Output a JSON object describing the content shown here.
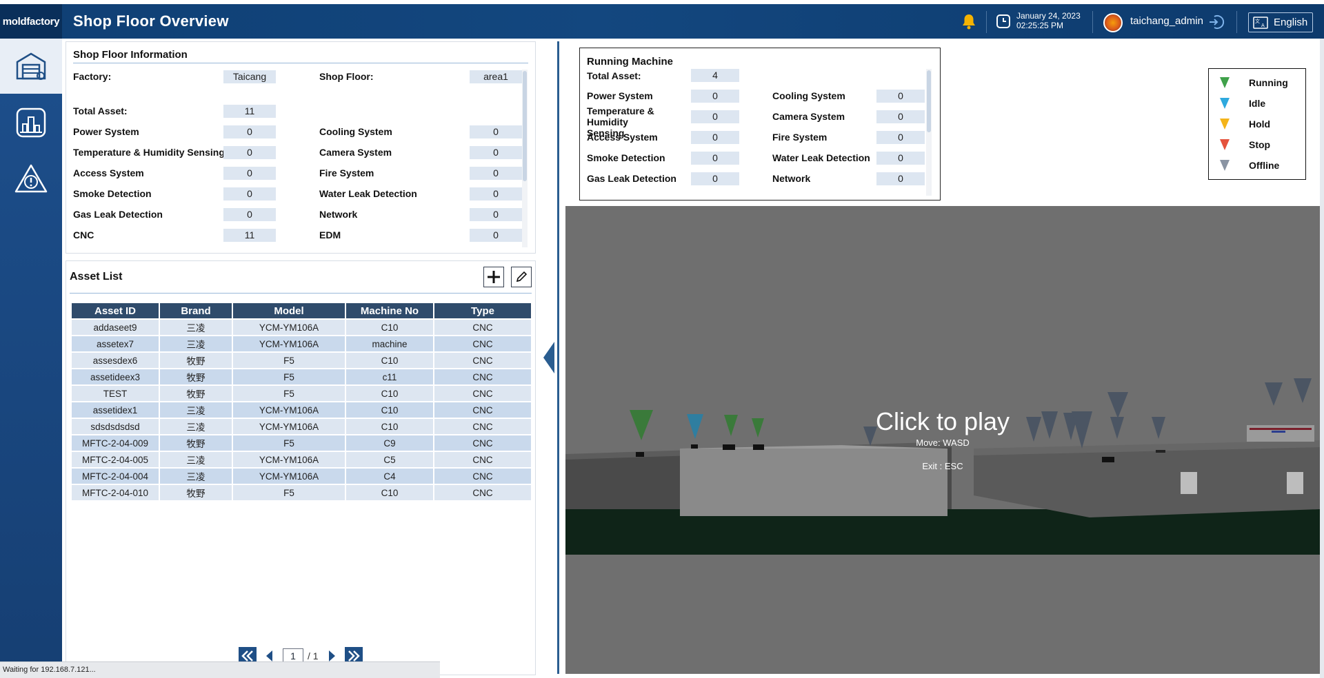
{
  "header": {
    "logo": "moldfactory",
    "title": "Shop Floor Overview",
    "date": "January 24, 2023",
    "time": "02:25:25 PM",
    "username": "taichang_admin",
    "language": "English"
  },
  "info": {
    "title": "Shop Floor Information",
    "factory_label": "Factory:",
    "factory_value": "Taicang",
    "shopfloor_label": "Shop Floor:",
    "shopfloor_value": "area1",
    "total_label": "Total Asset:",
    "total_value": "11",
    "rows": [
      {
        "l1": "Power System",
        "v1": "0",
        "l2": "Cooling System",
        "v2": "0"
      },
      {
        "l1": "Temperature & Humidity Sensing",
        "v1": "0",
        "l2": "Camera System",
        "v2": "0"
      },
      {
        "l1": "Access System",
        "v1": "0",
        "l2": "Fire System",
        "v2": "0"
      },
      {
        "l1": "Smoke Detection",
        "v1": "0",
        "l2": "Water Leak Detection",
        "v2": "0"
      },
      {
        "l1": "Gas Leak Detection",
        "v1": "0",
        "l2": "Network",
        "v2": "0"
      },
      {
        "l1": "CNC",
        "v1": "11",
        "l2": "EDM",
        "v2": "0"
      }
    ]
  },
  "assets": {
    "title": "Asset List",
    "columns": [
      "Asset ID",
      "Brand",
      "Model",
      "Machine No",
      "Type"
    ],
    "rows": [
      [
        "addaseet9",
        "三凌",
        "YCM-YM106A",
        "C10",
        "CNC"
      ],
      [
        "assetex7",
        "三凌",
        "YCM-YM106A",
        "machine",
        "CNC"
      ],
      [
        "assesdex6",
        "牧野",
        "F5",
        "C10",
        "CNC"
      ],
      [
        "assetideex3",
        "牧野",
        "F5",
        "c11",
        "CNC"
      ],
      [
        "TEST",
        "牧野",
        "F5",
        "C10",
        "CNC"
      ],
      [
        "assetidex1",
        "三凌",
        "YCM-YM106A",
        "C10",
        "CNC"
      ],
      [
        "sdsdsdsdsd",
        "三凌",
        "YCM-YM106A",
        "C10",
        "CNC"
      ],
      [
        "MFTC-2-04-009",
        "牧野",
        "F5",
        "C9",
        "CNC"
      ],
      [
        "MFTC-2-04-005",
        "三凌",
        "YCM-YM106A",
        "C5",
        "CNC"
      ],
      [
        "MFTC-2-04-004",
        "三凌",
        "YCM-YM106A",
        "C4",
        "CNC"
      ],
      [
        "MFTC-2-04-010",
        "牧野",
        "F5",
        "C10",
        "CNC"
      ]
    ],
    "page_current": "1",
    "page_total": "/ 1"
  },
  "running": {
    "title": "Running Machine",
    "total_label": "Total Asset:",
    "total_value": "4",
    "rows": [
      {
        "l1": "Power System",
        "v1": "0",
        "l2": "Cooling System",
        "v2": "0"
      },
      {
        "l1": "Temperature & Humidity Sensing",
        "v1": "0",
        "l2": "Camera System",
        "v2": "0"
      },
      {
        "l1": "Access System",
        "v1": "0",
        "l2": "Fire System",
        "v2": "0"
      },
      {
        "l1": "Smoke Detection",
        "v1": "0",
        "l2": "Water Leak Detection",
        "v2": "0"
      },
      {
        "l1": "Gas Leak Detection",
        "v1": "0",
        "l2": "Network",
        "v2": "0"
      }
    ]
  },
  "legend": [
    {
      "label": "Running",
      "color": "#3fa14a"
    },
    {
      "label": "Idle",
      "color": "#2ea9de"
    },
    {
      "label": "Hold",
      "color": "#f4b41a"
    },
    {
      "label": "Stop",
      "color": "#e5533d"
    },
    {
      "label": "Offline",
      "color": "#8a94a3"
    }
  ],
  "scene": {
    "play": "Click to play",
    "move": "Move: WASD",
    "exit": "Exit : ESC"
  },
  "status": "Waiting for 192.168.7.121..."
}
